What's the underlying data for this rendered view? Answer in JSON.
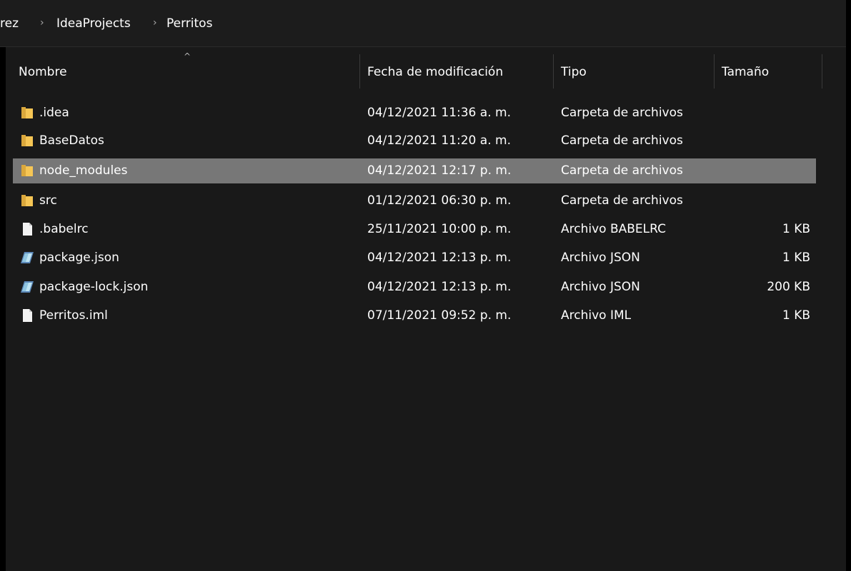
{
  "breadcrumb": {
    "items": [
      "rez",
      "IdeaProjects",
      "Perritos"
    ],
    "separator": ">"
  },
  "columns": {
    "name": "Nombre",
    "date": "Fecha de modificación",
    "type": "Tipo",
    "size": "Tamaño",
    "sort_indicator": "^"
  },
  "files": [
    {
      "name": ".idea",
      "date": "04/12/2021 11:36 a. m.",
      "type": "Carpeta de archivos",
      "size": "",
      "icon": "folder-icon"
    },
    {
      "name": "BaseDatos",
      "date": "04/12/2021 11:20 a. m.",
      "type": "Carpeta de archivos",
      "size": "",
      "icon": "folder-icon"
    },
    {
      "name": "node_modules",
      "date": "04/12/2021 12:17 p. m.",
      "type": "Carpeta de archivos",
      "size": "",
      "icon": "folder-icon",
      "selected": true
    },
    {
      "name": "src",
      "date": "01/12/2021 06:30 p. m.",
      "type": "Carpeta de archivos",
      "size": "",
      "icon": "folder-icon"
    },
    {
      "name": ".babelrc",
      "date": "25/11/2021 10:00 p. m.",
      "type": "Archivo BABELRC",
      "size": "1 KB",
      "icon": "file-icon"
    },
    {
      "name": "package.json",
      "date": "04/12/2021 12:13 p. m.",
      "type": "Archivo JSON",
      "size": "1 KB",
      "icon": "json-file-icon"
    },
    {
      "name": "package-lock.json",
      "date": "04/12/2021 12:13 p. m.",
      "type": "Archivo JSON",
      "size": "200 KB",
      "icon": "json-file-icon"
    },
    {
      "name": "Perritos.iml",
      "date": "07/11/2021 09:52 p. m.",
      "type": "Archivo IML",
      "size": "1 KB",
      "icon": "file-icon"
    }
  ],
  "colors": {
    "background": "#191919",
    "selected_row": "#777777",
    "folder": "#f6c655",
    "text": "#ffffff"
  }
}
